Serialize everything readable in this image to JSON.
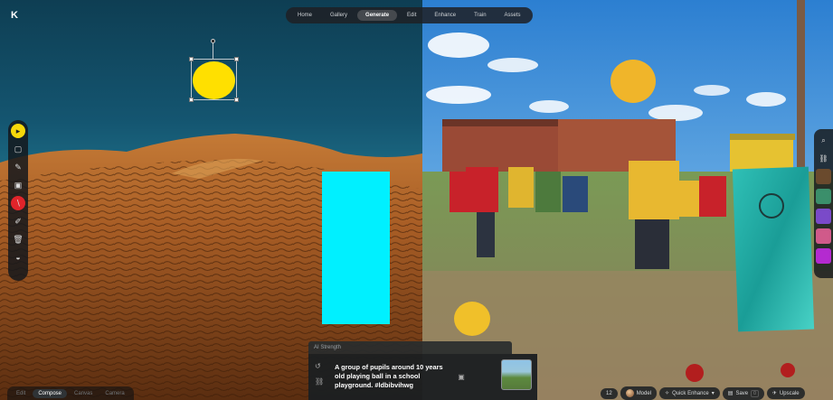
{
  "app": {
    "logo": "K"
  },
  "nav": {
    "items": [
      {
        "label": "Home",
        "active": false
      },
      {
        "label": "Gallery",
        "active": false
      },
      {
        "label": "Generate",
        "active": true
      },
      {
        "label": "Edit",
        "active": false
      },
      {
        "label": "Enhance",
        "active": false
      },
      {
        "label": "Train",
        "active": false
      },
      {
        "label": "Assets",
        "active": false
      }
    ]
  },
  "tools": [
    {
      "icon": "cursor-icon",
      "glyph": "▸"
    },
    {
      "icon": "square-icon",
      "glyph": "▢"
    },
    {
      "icon": "pen-icon",
      "glyph": "✎"
    },
    {
      "icon": "image-icon",
      "glyph": "▣"
    },
    {
      "icon": "eraser-icon",
      "glyph": "∖"
    },
    {
      "icon": "brush-icon",
      "glyph": "✐"
    },
    {
      "icon": "trash-icon",
      "glyph": "🗑"
    },
    {
      "icon": "mask-icon",
      "glyph": "◒"
    }
  ],
  "panel": {
    "strength_label": "AI Strength",
    "prompt": "A group of pupils around 10 years old playing ball in a school playground. #ldbibvihwg"
  },
  "bottom_left": {
    "items": [
      {
        "label": "Edit",
        "active": false
      },
      {
        "label": "Compose",
        "active": true
      },
      {
        "label": "Canvas",
        "active": false
      },
      {
        "label": "Camera",
        "active": false
      }
    ]
  },
  "bottom_right": {
    "count": "12",
    "model_label": "Model",
    "quick_enhance_label": "Quick Enhance",
    "save_label": "Save",
    "save_count": "0",
    "upscale_label": "Upscale"
  },
  "colors": {
    "accent_yellow": "#ffe000",
    "cyan_rect": "#00f0ff",
    "tool_red": "#e0242a"
  }
}
